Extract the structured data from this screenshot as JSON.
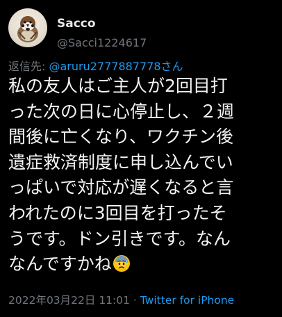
{
  "user": {
    "display_name": "Sacco",
    "handle": "@Sacci1224617",
    "avatar_icon": "sparrow-avatar-icon"
  },
  "reply": {
    "prefix": "返信先: ",
    "target": "@aruru2777887778さん"
  },
  "tweet": {
    "lines": [
      "私の友人はご主人が2回目打",
      "った次の日に心停止し、２週",
      "間後に亡くなり、ワクチン後",
      "遺症救済制度に申し込んでい",
      "っぱいで対応が遅くなると言",
      "われたのに3回目を打ったそ",
      "うです。ドン引きです。なん",
      "なんですかね"
    ],
    "emoji": "anxious-face-with-sweat-icon"
  },
  "meta": {
    "timestamp": "2022年03月22日 11:01",
    "separator": " · ",
    "source": "Twitter for iPhone"
  },
  "colors": {
    "background": "#000000",
    "text": "#f2f2f2",
    "secondary": "#71767b",
    "link": "#1d9bf0"
  }
}
